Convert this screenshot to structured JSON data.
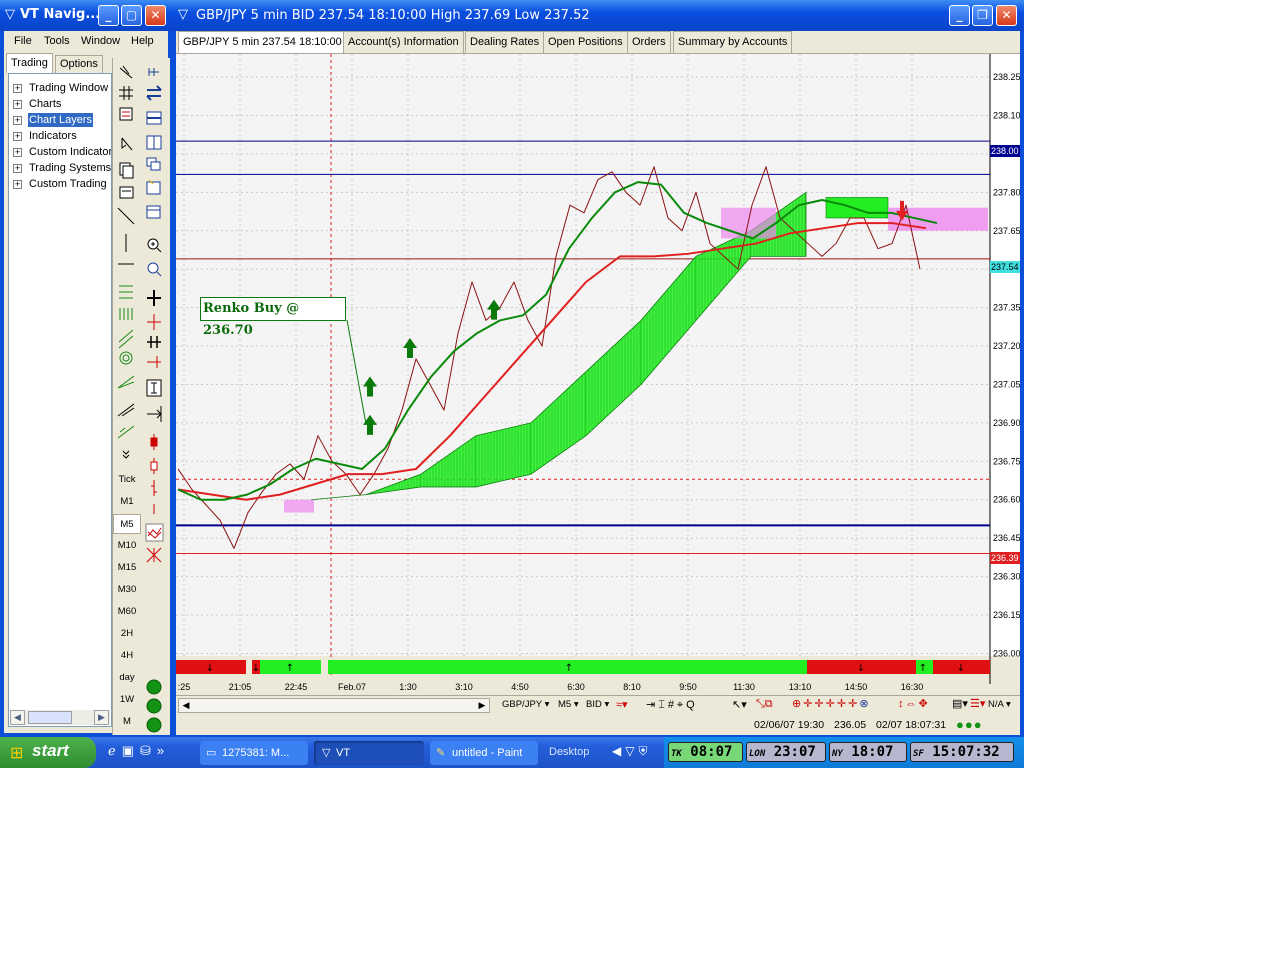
{
  "navigator": {
    "title": "VT Navig...",
    "menu": [
      "File",
      "Tools",
      "Window",
      "Help"
    ],
    "tabs": [
      "Trading",
      "Options"
    ],
    "tree": [
      "Trading Window",
      "Charts",
      "Chart Layers",
      "Indicators",
      "Custom Indicator",
      "Trading Systems",
      "Custom Trading"
    ],
    "selected_tree_item": "Chart Layers",
    "timeframes": [
      "Tick",
      "M1",
      "M5",
      "M10",
      "M15",
      "M30",
      "M60",
      "2H",
      "4H",
      "day",
      "1W",
      "M"
    ]
  },
  "chart_window": {
    "title": "GBP/JPY 5 min BID 237.54 18:10:00 High 237.69 Low 237.52",
    "tabs": [
      "GBP/JPY 5 min 237.54 18:10:00",
      "Account(s) Information",
      "Dealing Rates",
      "Open Positions",
      "Orders",
      "Summary by Accounts"
    ],
    "annotation": "Renko Buy @ 236.70",
    "toolbar": {
      "symbol": "GBP/JPY",
      "timeframe": "M5",
      "price_type": "BID",
      "zoom": "N/A"
    },
    "status": {
      "cursor_time": "02/06/07 19:30",
      "cursor_price": "236.05",
      "server_time": "02/07 18:07:31"
    },
    "price_tags": {
      "level_high": "238.00",
      "current": "237.54",
      "level_low": "236.39"
    }
  },
  "chart_data": {
    "type": "line",
    "symbol": "GBP/JPY",
    "y_ticks": [
      238.25,
      238.1,
      237.95,
      237.8,
      237.65,
      237.5,
      237.35,
      237.2,
      237.05,
      236.9,
      236.75,
      236.6,
      236.45,
      236.3,
      236.15,
      236.0
    ],
    "x_ticks": [
      ":25",
      "21:05",
      "22:45",
      "Feb.07",
      "1:30",
      "3:10",
      "4:50",
      "6:30",
      "8:10",
      "9:50",
      "11:30",
      "13:10",
      "14:50",
      "16:30"
    ],
    "ylim": [
      235.99,
      238.34
    ],
    "horizontal_levels": [
      238.0,
      237.87,
      237.54,
      236.68,
      236.5,
      236.39
    ],
    "price_series": [
      236.72,
      236.64,
      236.58,
      236.52,
      236.41,
      236.55,
      236.63,
      236.7,
      236.74,
      236.68,
      236.85,
      236.75,
      236.7,
      236.62,
      236.7,
      236.8,
      236.95,
      237.15,
      237.05,
      236.95,
      237.25,
      237.45,
      237.3,
      237.35,
      237.45,
      237.3,
      237.2,
      237.55,
      237.75,
      237.72,
      237.85,
      237.88,
      237.8,
      237.75,
      237.9,
      237.7,
      237.65,
      237.8,
      237.6,
      237.55,
      237.5,
      237.75,
      237.9,
      237.7,
      237.65,
      237.6,
      237.55,
      237.6,
      237.7,
      237.7,
      237.58,
      237.6,
      237.75,
      237.5
    ],
    "ma_green": [
      236.64,
      236.6,
      236.6,
      236.62,
      236.66,
      236.72,
      236.76,
      236.74,
      236.72,
      236.8,
      236.95,
      237.08,
      237.18,
      237.25,
      237.3,
      237.32,
      237.4,
      237.58,
      237.7,
      237.8,
      237.84,
      237.83,
      237.72,
      237.68,
      237.65,
      237.62,
      237.68,
      237.75,
      237.77,
      237.75,
      237.72,
      237.72,
      237.7,
      237.68
    ],
    "ma_red": [
      236.64,
      236.62,
      236.6,
      236.62,
      236.66,
      236.7,
      236.7,
      236.72,
      236.85,
      237.0,
      237.15,
      237.3,
      237.45,
      237.55,
      237.55,
      237.56,
      237.58,
      237.6,
      237.64,
      237.66,
      237.68,
      237.68,
      237.66
    ],
    "cloud_green_upper": [
      236.6,
      236.62,
      236.7,
      236.85,
      236.9,
      237.1,
      237.3,
      237.55,
      237.65,
      237.8
    ],
    "cloud_green_lower": [
      236.6,
      236.62,
      236.65,
      236.65,
      236.7,
      236.85,
      237.05,
      237.3,
      237.55,
      237.55
    ],
    "buy_arrows": [
      236.9,
      237.05,
      237.2,
      237.35
    ],
    "sell_arrows": [
      237.72
    ],
    "signal_bar": [
      "down",
      "down",
      "up",
      "up",
      "down",
      "down",
      "up",
      "down"
    ]
  },
  "taskbar": {
    "start": "start",
    "buttons": [
      "1275381: M...",
      "VT",
      "untitled - Paint"
    ],
    "desktop": "Desktop",
    "clocks": [
      {
        "tz": "TK",
        "time": "08:07"
      },
      {
        "tz": "LON",
        "time": "23:07"
      },
      {
        "tz": "NY",
        "time": "18:07"
      },
      {
        "tz": "SF",
        "time": "15:07:32"
      }
    ]
  },
  "colors": {
    "xp_blue": "#0a4ee0",
    "cloud_green": "#22ee22",
    "cloud_pink": "#ee88ee",
    "ma_red": "#e02020",
    "ma_green": "#0a8a0a",
    "price_line": "#8b1010",
    "level_blue": "#000090"
  }
}
